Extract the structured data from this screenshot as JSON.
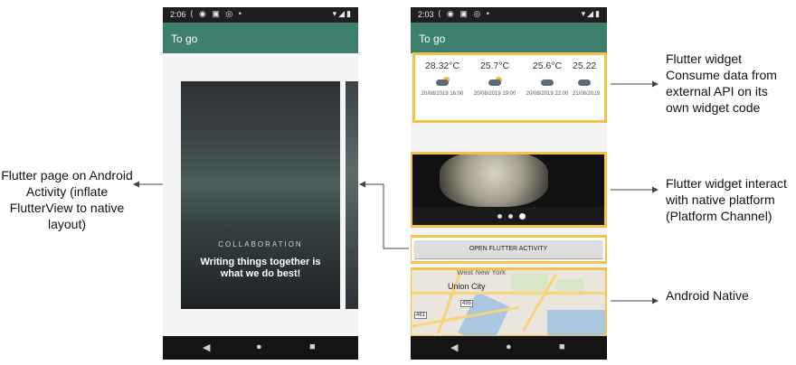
{
  "left_phone": {
    "status_time": "2:06",
    "app_title": "To go",
    "card_kicker": "COLLABORATION",
    "card_text": "Writing things together is what we do best!"
  },
  "right_phone": {
    "status_time": "2:03",
    "app_title": "To go",
    "weather": [
      {
        "temp": "28.32°C",
        "date": "20/08/2019 16:00"
      },
      {
        "temp": "25.7°C",
        "date": "20/08/2019 19:00"
      },
      {
        "temp": "25.6°C",
        "date": "20/08/2019 22:00"
      },
      {
        "temp": "25.22",
        "date": "21/08/2019"
      }
    ],
    "button_label": "OPEN FLUTTER ACTIVITY",
    "map": {
      "city": "Union City",
      "street": "West New York",
      "route1": "495",
      "route2": "461"
    }
  },
  "annotations": {
    "left": "Flutter page on Android Activity (inflate FlutterView to native layout)",
    "api": "Flutter widget Consume data from external API on its own widget code",
    "platform": "Flutter widget interact with native platform (Platform Channel)",
    "native": "Android Native"
  },
  "colors": {
    "app_bar": "#3d7f6f",
    "highlight": "#f2c34b"
  }
}
